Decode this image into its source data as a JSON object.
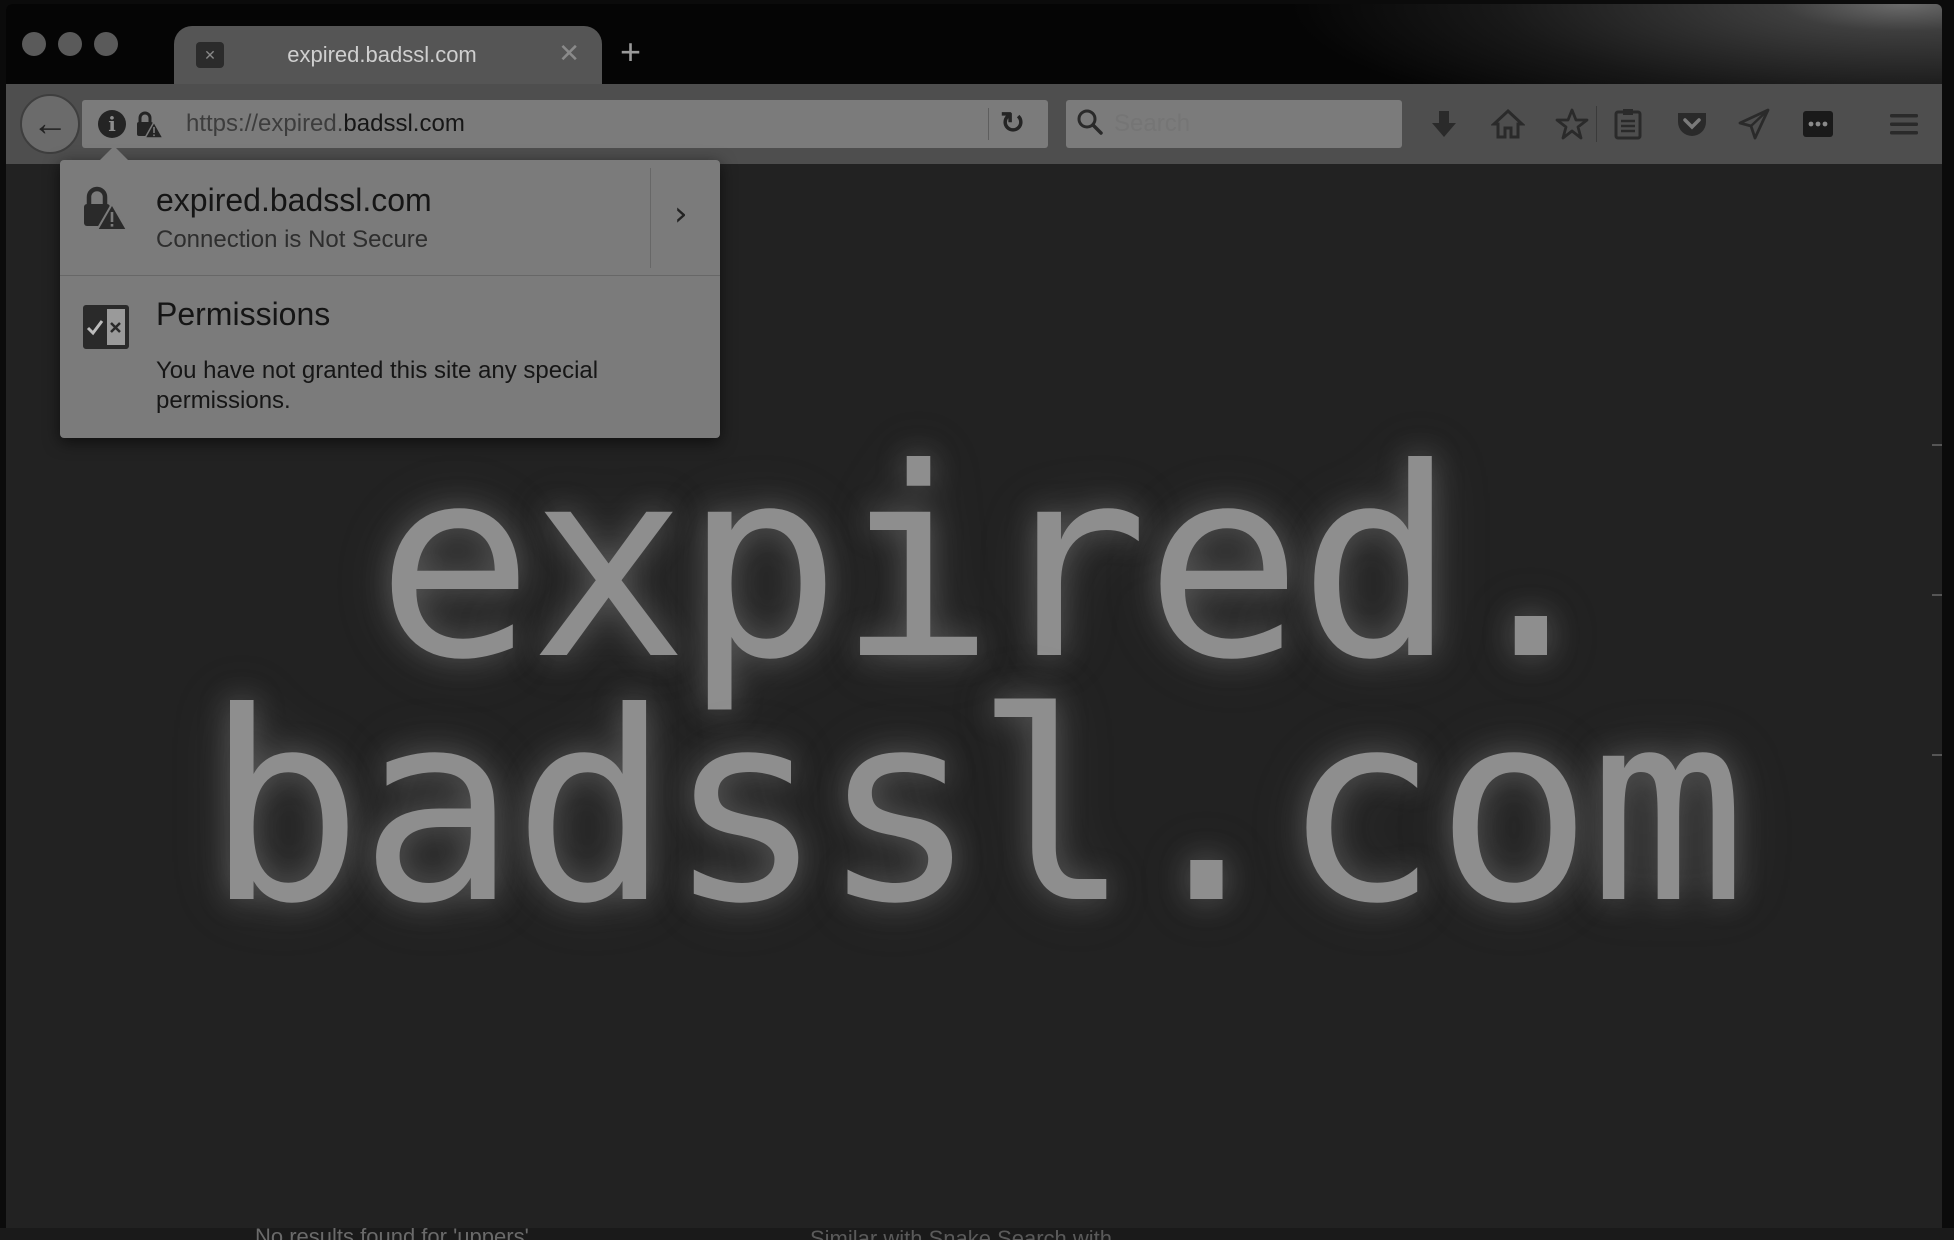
{
  "tab": {
    "title": "expired.badssl.com",
    "close_glyph": "✕",
    "new_tab_glyph": "+"
  },
  "nav": {
    "back_glyph": "←",
    "url_scheme_sub": "https://expired.",
    "url_domain": "badssl.com",
    "reload_glyph": "↻",
    "search_placeholder": "Search"
  },
  "content": {
    "line1": "expired.",
    "line2": "badssl.com"
  },
  "popup": {
    "host": "expired.badssl.com",
    "status": "Connection is Not Secure",
    "chevron": "›",
    "permissions_title": "Permissions",
    "permissions_desc": "You have not granted this site any special permissions."
  },
  "background": {
    "fragment_left": "No results found for 'uppers'",
    "fragment_right": "Similar with Snake  Search with"
  },
  "colors": {
    "chrome": "#4e4e4e",
    "urlbar": "#7b7b7b",
    "page": "#222222",
    "title_text": "#8e8e8e"
  }
}
